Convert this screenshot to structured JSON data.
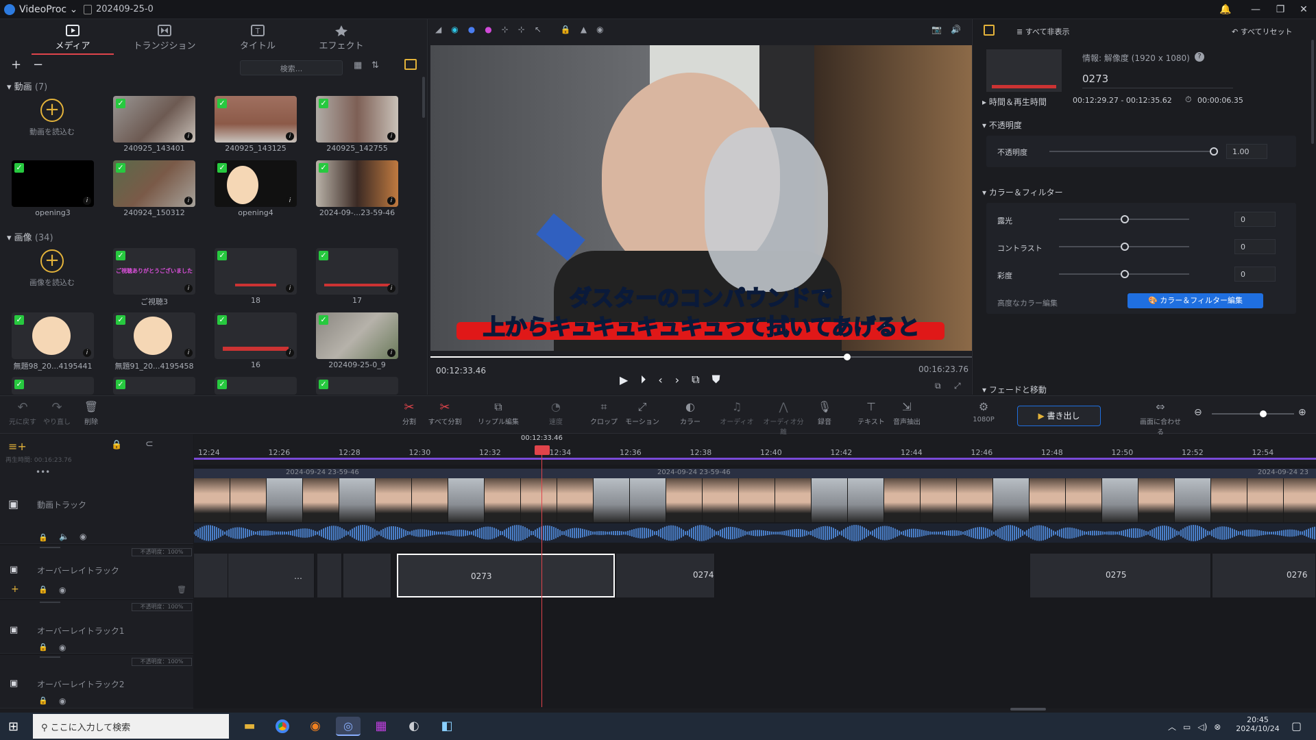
{
  "app": {
    "name": "VideoProc",
    "project": "202409-25-0"
  },
  "left_tabs": [
    {
      "label": "メディア"
    },
    {
      "label": "トランジション"
    },
    {
      "label": "タイトル"
    },
    {
      "label": "エフェクト"
    }
  ],
  "search_placeholder": "検索...",
  "video_section": {
    "title": "動画",
    "count": "(7)",
    "add_label": "動画を読込む",
    "items": [
      "240925_143401",
      "240925_143125",
      "240925_142755",
      "opening3",
      "240924_150312",
      "opening4",
      "2024-09-...23-59-46"
    ]
  },
  "image_section": {
    "title": "画像",
    "count": "(34)",
    "add_label": "画像を読込む",
    "items": [
      "ご視聴3",
      "18",
      "17",
      "無題98_20...4195441",
      "無題91_20...4195458",
      "16",
      "202409-25-0_9"
    ]
  },
  "thumb_texts": {
    "goshichou": "ご視聴ありがとうございました"
  },
  "preview": {
    "subtitle_line1": "ダスターのコンパウンドで",
    "subtitle_line2_a": "上から",
    "subtitle_line2_b": "キュキュキュキュ",
    "subtitle_line2_c": "って拭いてあげると",
    "current_time": "00:12:33.46",
    "total_time": "00:16:23.76",
    "progress": 0.77
  },
  "right": {
    "hide_all": "すべて非表示",
    "reset_all": "すべてリセット",
    "info": "情報: 解像度 (1920 x 1080)",
    "clip_name": "0273",
    "time_section": "時間＆再生時間",
    "time_range": "00:12:29.27 - 00:12:35.62",
    "duration": "00:00:06.35",
    "opacity_section": "不透明度",
    "opacity_label": "不透明度",
    "opacity_value": "1.00",
    "color_section": "カラー＆フィルター",
    "exposure": "露光",
    "contrast": "コントラスト",
    "saturation": "彩度",
    "zero": "0",
    "advanced_color": "高度なカラー編集",
    "color_btn": "カラー＆フィルター編集",
    "fade_section": "フェードと移動"
  },
  "toolbar": {
    "undo": "元に戻す",
    "redo": "やり直し",
    "delete": "削除",
    "split": "分割",
    "split_all": "すべて分割",
    "ripple": "リップル編集",
    "speed": "速度",
    "crop": "クロップ",
    "motion": "モーション",
    "color": "カラー",
    "audio": "オーディオ",
    "audio_split": "オーディオ分離",
    "record": "録音",
    "text": "テキスト",
    "audio_extract": "音声抽出",
    "res": "1080P",
    "export": "書き出し",
    "fit": "画面に合わせる"
  },
  "timeline": {
    "playhead_time": "00:12:33.46",
    "total_label": "再生時間: 00:16:23.76",
    "ticks": [
      "12:24",
      "12:26",
      "12:28",
      "12:30",
      "12:32",
      "12:34",
      "12:36",
      "12:38",
      "12:40",
      "12:42",
      "12:44",
      "12:46",
      "12:48",
      "12:50",
      "12:52",
      "12:54"
    ],
    "video_track": "動画トラック",
    "overlay": "オーバーレイトラック",
    "overlay1": "オーバーレイトラック1",
    "overlay2": "オーバーレイトラック2",
    "opacity_tag": "不透明度：100%",
    "clip_date1": "2024-09-24 23-59-46",
    "clip_date2": "2024-09-24 23-59-46",
    "clip_date3": "2024-09-24 23",
    "overlay_clips": [
      "0273",
      "0274",
      "0275",
      "0276"
    ]
  },
  "taskbar": {
    "search": "ここに入力して検索",
    "time": "20:45",
    "date": "2024/10/24"
  },
  "colors": {
    "accent_red": "#e0444b",
    "accent_blue": "#1f6fe0",
    "yellow": "#e4b33a",
    "check_green": "#27c93f"
  }
}
